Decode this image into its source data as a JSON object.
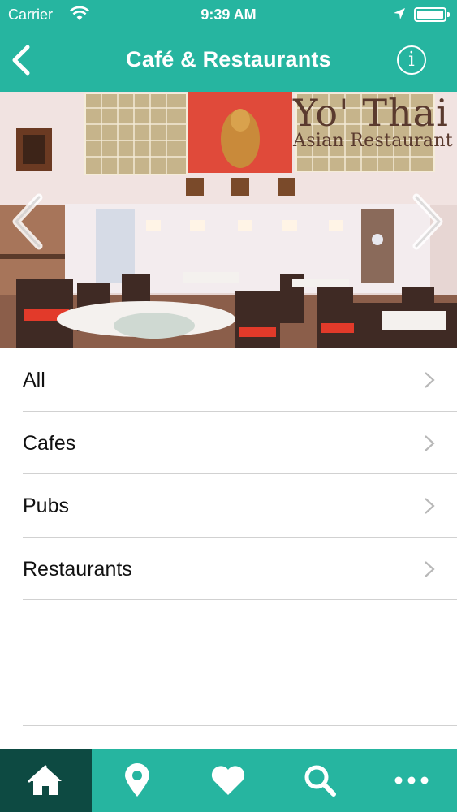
{
  "status_bar": {
    "carrier": "Carrier",
    "time": "9:39 AM",
    "icons": [
      "wifi-icon",
      "location-arrow-icon",
      "battery-icon"
    ]
  },
  "nav_bar": {
    "back_icon": "chevron-left-icon",
    "title": "Café & Restaurants",
    "info_icon": "info-icon",
    "info_glyph": "i"
  },
  "hero": {
    "brand_name": "Yo' Thai",
    "brand_subtitle": "Asian Restaurant",
    "prev_icon": "chevron-left-icon",
    "next_icon": "chevron-right-icon"
  },
  "categories": [
    {
      "label": "All"
    },
    {
      "label": "Cafes"
    },
    {
      "label": "Pubs"
    },
    {
      "label": "Restaurants"
    }
  ],
  "tab_bar": {
    "items": [
      {
        "icon": "home-icon",
        "active": true
      },
      {
        "icon": "map-pin-icon",
        "active": false
      },
      {
        "icon": "heart-icon",
        "active": false
      },
      {
        "icon": "search-icon",
        "active": false
      },
      {
        "icon": "more-icon",
        "active": false
      }
    ]
  },
  "colors": {
    "accent": "#26b5a0",
    "tab_active": "#0d4a42",
    "separator": "#d1d1d1",
    "chevron": "#b8b8b8"
  }
}
